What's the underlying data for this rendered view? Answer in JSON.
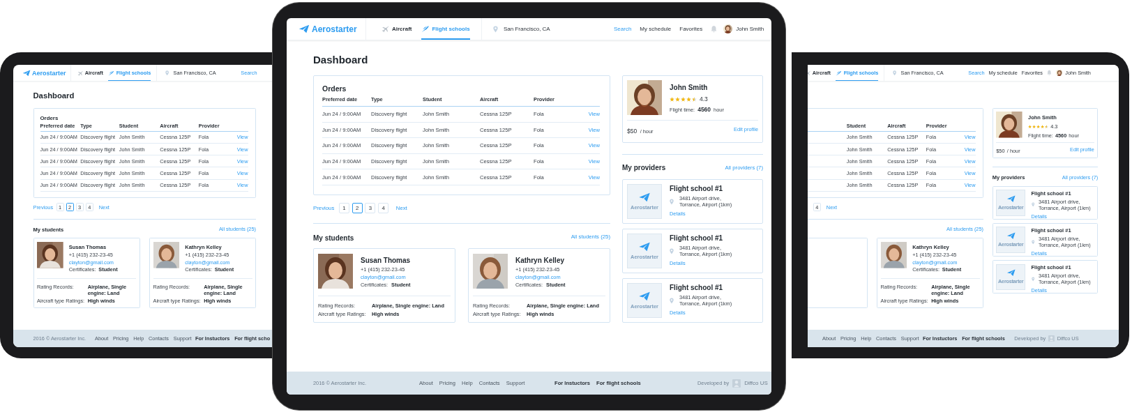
{
  "devices": [
    {
      "kind": "left",
      "header": {
        "logo": "Aerostarter",
        "nav": [
          {
            "label": "Aircraft",
            "selected": false
          },
          {
            "label": "Flight schools",
            "selected": true
          }
        ],
        "location": "San Francisco, CA",
        "links": [
          {
            "label": "Search",
            "selected": true
          }
        ]
      },
      "title": "Dashboard",
      "orders": {
        "title": "Orders",
        "columns": [
          "Preferred date",
          "Type",
          "Student",
          "Aircraft",
          "Provider"
        ],
        "rows": [
          {
            "cells": [
              "Jun 24 / 9:00AM",
              "Discovery flight",
              "John Smith",
              "Cessna 125P",
              "Fola"
            ],
            "action": "View"
          },
          {
            "cells": [
              "Jun 24 / 9:00AM",
              "Discovery flight",
              "John Smith",
              "Cessna 125P",
              "Fola"
            ],
            "action": "View"
          },
          {
            "cells": [
              "Jun 24 / 9:00AM",
              "Discovery flight",
              "John Smith",
              "Cessna 125P",
              "Fola"
            ],
            "action": "View"
          },
          {
            "cells": [
              "Jun 24 / 9:00AM",
              "Discovery flight",
              "John Smith",
              "Cessna 125P",
              "Fola"
            ],
            "action": "View"
          },
          {
            "cells": [
              "Jun 24 / 9:00AM",
              "Discovery flight",
              "John Smith",
              "Cessna 125P",
              "Fola"
            ],
            "action": "View"
          }
        ]
      },
      "pagination": {
        "previous": "Previous",
        "pages": [
          {
            "label": "1",
            "selected": false
          },
          {
            "label": "2",
            "selected": true
          },
          {
            "label": "3",
            "selected": false
          },
          {
            "label": "4",
            "selected": false
          }
        ],
        "next": "Next"
      },
      "students": {
        "title": "My students",
        "all_link": "All students (25)",
        "cards": [
          {
            "kind": "full",
            "name": "Susan Thomas",
            "phone": "+1 (415) 232-23-45",
            "email": "clayton@gmail.com",
            "certificates_label": "Certificates:",
            "certificates": "Student",
            "records": [
              {
                "label": "Rating Records:",
                "value": "Airplane, Single engine: Land"
              },
              {
                "label": "Aircraft type Ratings:",
                "value": "High winds"
              }
            ]
          },
          {
            "kind": "full",
            "name": "Kathryn Kelley",
            "phone": "+1 (415) 232-23-45",
            "email": "clayton@gmail.com",
            "certificates_label": "Certificates:",
            "certificates": "Student",
            "records": [
              {
                "label": "Rating Records:",
                "value": "Airplane, Single engine: Land"
              },
              {
                "label": "Aircraft type Ratings:",
                "value": "High winds"
              }
            ]
          }
        ]
      },
      "footer": {
        "copyright": "2016 © Aerostarter Inc.",
        "links": [
          "About",
          "Pricing",
          "Help",
          "Contacts",
          "Support"
        ],
        "audience": [
          "For Instuctors",
          "For flight scho"
        ]
      }
    },
    {
      "kind": "center",
      "header": {
        "logo": "Aerostarter",
        "nav": [
          {
            "label": "Aircraft",
            "selected": false
          },
          {
            "label": "Flight schools",
            "selected": true
          }
        ],
        "location": "San Francisco, CA",
        "links": [
          {
            "label": "Search",
            "selected": true
          },
          {
            "label": "My schedule",
            "selected": false
          },
          {
            "label": "Favorites",
            "selected": false
          }
        ],
        "user": "John Smith"
      },
      "title": "Dashboard",
      "orders": {
        "title": "Orders",
        "columns": [
          "Preferred date",
          "Type",
          "Student",
          "Aircraft",
          "Provider"
        ],
        "rows": [
          {
            "cells": [
              "Jun 24 / 9:00AM",
              "Discovery flight",
              "John Smith",
              "Cessna 125P",
              "Fola"
            ],
            "action": "View"
          },
          {
            "cells": [
              "Jun 24 / 9:00AM",
              "Discovery flight",
              "John Smith",
              "Cessna 125P",
              "Fola"
            ],
            "action": "View"
          },
          {
            "cells": [
              "Jun 24 / 9:00AM",
              "Discovery flight",
              "John Smith",
              "Cessna 125P",
              "Fola"
            ],
            "action": "View"
          },
          {
            "cells": [
              "Jun 24 / 9:00AM",
              "Discovery flight",
              "John Smith",
              "Cessna 125P",
              "Fola"
            ],
            "action": "View"
          },
          {
            "cells": [
              "Jun 24 / 9:00AM",
              "Discovery flight",
              "John Smith",
              "Cessna 125P",
              "Fola"
            ],
            "action": "View"
          }
        ]
      },
      "pagination": {
        "previous": "Previous",
        "pages": [
          {
            "label": "1",
            "selected": false
          },
          {
            "label": "2",
            "selected": true
          },
          {
            "label": "3",
            "selected": false
          },
          {
            "label": "4",
            "selected": false
          }
        ],
        "next": "Next"
      },
      "students": {
        "title": "My students",
        "all_link": "All students (25)",
        "cards": [
          {
            "kind": "full",
            "name": "Susan Thomas",
            "phone": "+1 (415) 232-23-45",
            "email": "clayton@gmail.com",
            "certificates_label": "Certificates:",
            "certificates": "Student",
            "records": [
              {
                "label": "Rating Records:",
                "value": "Airplane, Single engine: Land"
              },
              {
                "label": "Aircraft type Ratings:",
                "value": "High winds"
              }
            ]
          },
          {
            "kind": "full",
            "name": "Kathryn Kelley",
            "phone": "+1 (415) 232-23-45",
            "email": "clayton@gmail.com",
            "certificates_label": "Certificates:",
            "certificates": "Student",
            "records": [
              {
                "label": "Rating Records:",
                "value": "Airplane, Single engine: Land"
              },
              {
                "label": "Aircraft type Ratings:",
                "value": "High winds"
              }
            ]
          }
        ]
      },
      "profile": {
        "name": "John Smith",
        "stars": 4.5,
        "rating": "4.3",
        "flight_time_label": "Flight time:",
        "flight_time": "4560",
        "flight_time_unit": "hour",
        "price": "$50",
        "price_unit": "/ hour",
        "edit": "Edit profile"
      },
      "providers": {
        "title": "My providers",
        "all_link": "All providers (7)",
        "cards": [
          {
            "logo_text": "Aerostarter",
            "name": "Flight school #1",
            "address": [
              "3481 Airport drive,",
              "Torrance, Airport (1km)"
            ],
            "details": "Details"
          },
          {
            "logo_text": "Aerostarter",
            "name": "Flight school #1",
            "address": [
              "3481 Airport drive,",
              "Torrance, Airport (1km)"
            ],
            "details": "Details"
          },
          {
            "logo_text": "Aerostarter",
            "name": "Flight school #1",
            "address": [
              "3481 Airport drive,",
              "Torrance, Airport (1km)"
            ],
            "details": "Details"
          }
        ]
      },
      "footer": {
        "copyright": "2016 © Aerostarter Inc.",
        "links": [
          "About",
          "Pricing",
          "Help",
          "Contacts",
          "Support"
        ],
        "audience": [
          "For Instuctors",
          "For flight schools"
        ],
        "developed_by": "Developed by",
        "developer": "Diffco US"
      }
    },
    {
      "kind": "right",
      "header": {
        "nav": [
          {
            "label": "Aircraft",
            "selected": false
          },
          {
            "label": "Flight schools",
            "selected": true
          }
        ],
        "location": "San Francisco, CA",
        "links": [
          {
            "label": "Search",
            "selected": true
          },
          {
            "label": "My schedule",
            "selected": false
          },
          {
            "label": "Favorites",
            "selected": false
          }
        ],
        "user": "John Smith"
      },
      "orders": {
        "columns": [
          "Student",
          "Aircraft",
          "Provider"
        ],
        "rows": [
          {
            "cells": [
              "John Smith",
              "Cessna 125P",
              "Fola"
            ],
            "action": "View"
          },
          {
            "cells": [
              "John Smith",
              "Cessna 125P",
              "Fola"
            ],
            "action": "View"
          },
          {
            "cells": [
              "John Smith",
              "Cessna 125P",
              "Fola"
            ],
            "action": "View"
          },
          {
            "cells": [
              "John Smith",
              "Cessna 125P",
              "Fola"
            ],
            "action": "View"
          },
          {
            "cells": [
              "John Smith",
              "Cessna 125P",
              "Fola"
            ],
            "action": "View"
          }
        ]
      },
      "pagination": {
        "pages": [
          {
            "label": "4",
            "selected": false
          }
        ],
        "next": "Next"
      },
      "students": {
        "all_link": "All students (25)",
        "cards": [
          {
            "kind": "cut"
          },
          {
            "kind": "full",
            "name": "Kathryn Kelley",
            "phone": "+1 (415) 232-23-45",
            "email": "clayton@gmail.com",
            "certificates_label": "Certificates:",
            "certificates": "Student",
            "records": [
              {
                "label": "Rating Records:",
                "value": "Airplane, Single engine: Land"
              },
              {
                "label": "Aircraft type Ratings:",
                "value": "High winds"
              }
            ]
          }
        ]
      },
      "profile": {
        "name": "John Smith",
        "stars": 4.5,
        "rating": "4.3",
        "flight_time_label": "Flight time:",
        "flight_time": "4560",
        "flight_time_unit": "hour",
        "price": "$50",
        "price_unit": "/ hour",
        "edit": "Edit profile"
      },
      "providers": {
        "title": "My providers",
        "all_link": "All providers (7)",
        "cards": [
          {
            "logo_text": "Aerostarter",
            "name": "Flight school #1",
            "address": [
              "3481 Airport drive,",
              "Torrance, Airport (1km)"
            ],
            "details": "Details"
          },
          {
            "logo_text": "Aerostarter",
            "name": "Flight school #1",
            "address": [
              "3481 Airport drive,",
              "Torrance, Airport (1km)"
            ],
            "details": "Details"
          },
          {
            "logo_text": "Aerostarter",
            "name": "Flight school #1",
            "address": [
              "3481 Airport drive,",
              "Torrance, Airport (1km)"
            ],
            "details": "Details"
          }
        ]
      },
      "footer": {
        "links": [
          "About",
          "Pricing",
          "Help",
          "Contacts",
          "Support"
        ],
        "audience": [
          "For Instuctors",
          "For flight schools"
        ],
        "developed_by": "Developed by",
        "developer": "Diffco US"
      }
    }
  ]
}
